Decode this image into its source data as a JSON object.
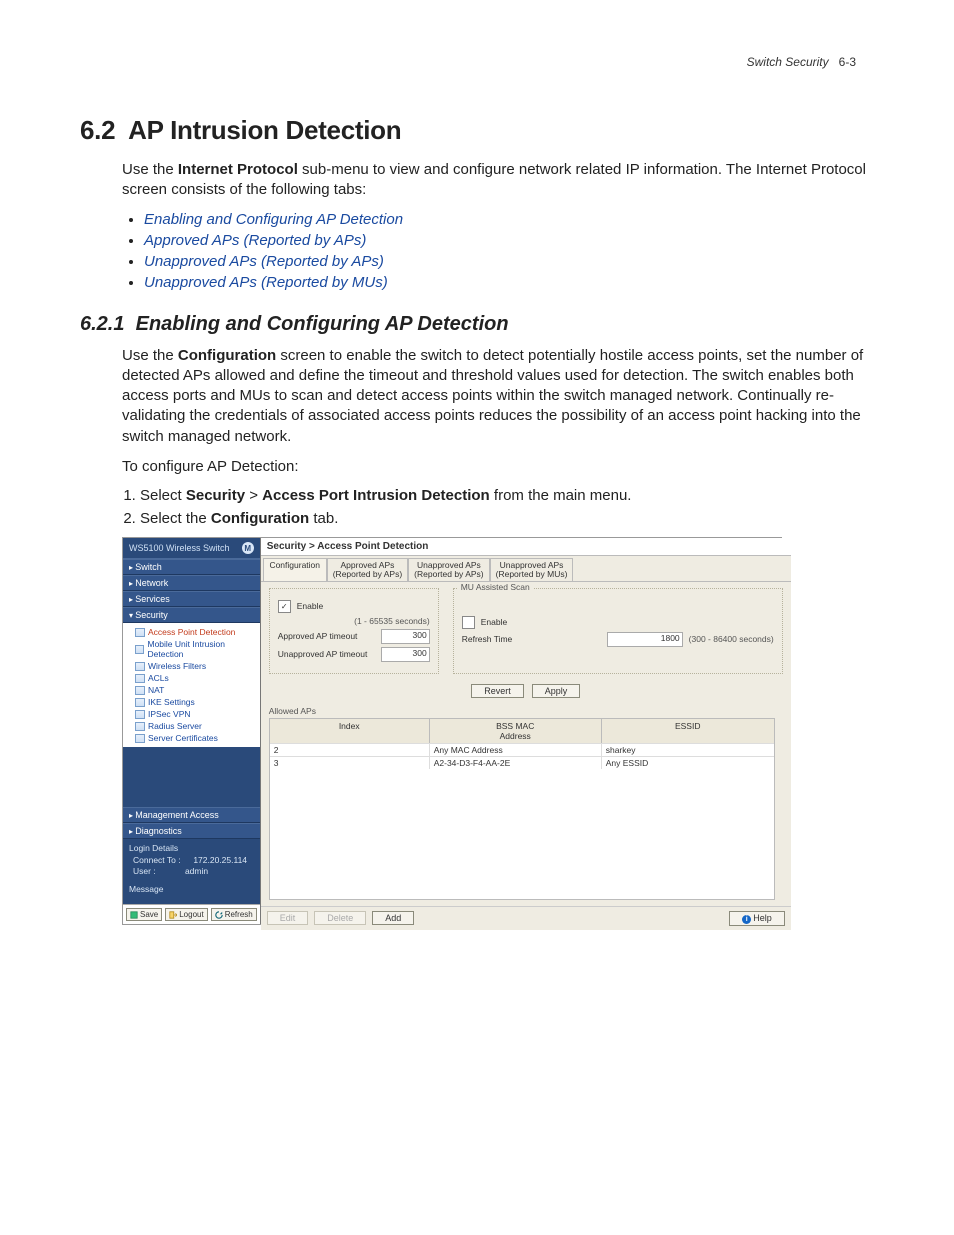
{
  "runhead": {
    "label": "Switch Security",
    "page": "6-3"
  },
  "section62": {
    "number": "6.2",
    "title": "AP Intrusion Detection",
    "intro_pre": "Use the ",
    "intro_bold": "Internet Protocol",
    "intro_post": " sub-menu to view and configure network related IP information. The Internet Protocol screen consists of the following tabs:",
    "links": [
      "Enabling and Configuring AP Detection",
      "Approved APs (Reported by APs)",
      "Unapproved APs (Reported by APs)",
      "Unapproved APs (Reported by MUs)"
    ]
  },
  "section621": {
    "number": "6.2.1",
    "title": "Enabling and Configuring AP Detection",
    "para_pre": "Use the ",
    "para_bold": "Configuration",
    "para_post": " screen to enable the switch to detect potentially hostile access points, set the number of detected APs allowed and define the timeout and threshold values used for detection. The switch enables both access ports and MUs to scan and detect access points within the switch managed network. Continually re-validating the credentials of associated access points reduces the possibility of an access point hacking into the switch managed network.",
    "line2": "To configure AP Detection:",
    "step1_pre": "Select ",
    "step1_b1": "Security",
    "step1_gt": " > ",
    "step1_b2": "Access Port Intrusion Detection",
    "step1_post": " from the main menu.",
    "step2_pre": "Select the ",
    "step2_b": "Configuration",
    "step2_post": " tab."
  },
  "shot": {
    "brand": "WS5100 Wireless Switch",
    "logoM": "M",
    "nav": {
      "switch": "Switch",
      "network": "Network",
      "services": "Services",
      "security": "Security",
      "mgmt": "Management Access",
      "diag": "Diagnostics"
    },
    "tree": [
      "Access Point Detection",
      "Mobile Unit Intrusion Detection",
      "Wireless Filters",
      "ACLs",
      "NAT",
      "IKE Settings",
      "IPSec VPN",
      "Radius Server",
      "Server Certificates"
    ],
    "login": {
      "title": "Login Details",
      "connect_lbl": "Connect To :",
      "connect_val": "172.20.25.114",
      "user_lbl": "User :",
      "user_val": "admin",
      "msg_title": "Message"
    },
    "sidebtns": {
      "save": "Save",
      "logout": "Logout",
      "refresh": "Refresh"
    },
    "crumb": "Security > Access Point Detection",
    "tabs": [
      "Configuration",
      "Approved APs\n(Reported by APs)",
      "Unapproved APs\n(Reported by APs)",
      "Unapproved APs\n(Reported by MUs)"
    ],
    "leftgroup": {
      "enable": "Enable",
      "range": "(1 - 65535 seconds)",
      "approved_lbl": "Approved AP timeout",
      "approved_val": "300",
      "unapproved_lbl": "Unapproved AP timeout",
      "unapproved_val": "300"
    },
    "rightgroup": {
      "legend": "MU Assisted Scan",
      "enable": "Enable",
      "refresh_lbl": "Refresh Time",
      "refresh_val": "1800",
      "range": "(300 - 86400 seconds)"
    },
    "buttons": {
      "revert": "Revert",
      "apply": "Apply"
    },
    "allowed_label": "Allowed APs",
    "table": {
      "headers": [
        "Index",
        "BSS MAC\nAddress",
        "ESSID"
      ],
      "rows": [
        {
          "index": "2",
          "mac": "Any MAC Address",
          "essid": "sharkey"
        },
        {
          "index": "3",
          "mac": "A2-34-D3-F4-AA-2E",
          "essid": "Any ESSID"
        }
      ]
    },
    "footer": {
      "edit": "Edit",
      "delete": "Delete",
      "add": "Add",
      "help": "Help"
    }
  }
}
